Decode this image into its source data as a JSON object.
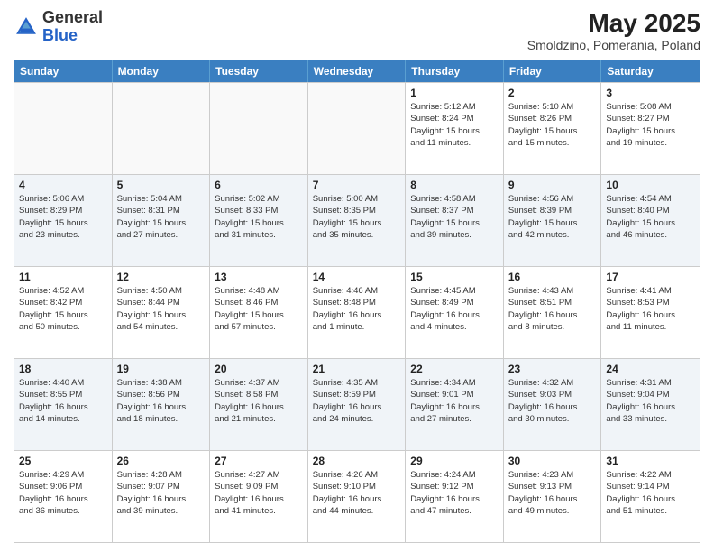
{
  "logo": {
    "general": "General",
    "blue": "Blue"
  },
  "header": {
    "title": "May 2025",
    "subtitle": "Smoldzino, Pomerania, Poland"
  },
  "weekdays": [
    "Sunday",
    "Monday",
    "Tuesday",
    "Wednesday",
    "Thursday",
    "Friday",
    "Saturday"
  ],
  "rows": [
    [
      {
        "day": "",
        "info": ""
      },
      {
        "day": "",
        "info": ""
      },
      {
        "day": "",
        "info": ""
      },
      {
        "day": "",
        "info": ""
      },
      {
        "day": "1",
        "info": "Sunrise: 5:12 AM\nSunset: 8:24 PM\nDaylight: 15 hours\nand 11 minutes."
      },
      {
        "day": "2",
        "info": "Sunrise: 5:10 AM\nSunset: 8:26 PM\nDaylight: 15 hours\nand 15 minutes."
      },
      {
        "day": "3",
        "info": "Sunrise: 5:08 AM\nSunset: 8:27 PM\nDaylight: 15 hours\nand 19 minutes."
      }
    ],
    [
      {
        "day": "4",
        "info": "Sunrise: 5:06 AM\nSunset: 8:29 PM\nDaylight: 15 hours\nand 23 minutes."
      },
      {
        "day": "5",
        "info": "Sunrise: 5:04 AM\nSunset: 8:31 PM\nDaylight: 15 hours\nand 27 minutes."
      },
      {
        "day": "6",
        "info": "Sunrise: 5:02 AM\nSunset: 8:33 PM\nDaylight: 15 hours\nand 31 minutes."
      },
      {
        "day": "7",
        "info": "Sunrise: 5:00 AM\nSunset: 8:35 PM\nDaylight: 15 hours\nand 35 minutes."
      },
      {
        "day": "8",
        "info": "Sunrise: 4:58 AM\nSunset: 8:37 PM\nDaylight: 15 hours\nand 39 minutes."
      },
      {
        "day": "9",
        "info": "Sunrise: 4:56 AM\nSunset: 8:39 PM\nDaylight: 15 hours\nand 42 minutes."
      },
      {
        "day": "10",
        "info": "Sunrise: 4:54 AM\nSunset: 8:40 PM\nDaylight: 15 hours\nand 46 minutes."
      }
    ],
    [
      {
        "day": "11",
        "info": "Sunrise: 4:52 AM\nSunset: 8:42 PM\nDaylight: 15 hours\nand 50 minutes."
      },
      {
        "day": "12",
        "info": "Sunrise: 4:50 AM\nSunset: 8:44 PM\nDaylight: 15 hours\nand 54 minutes."
      },
      {
        "day": "13",
        "info": "Sunrise: 4:48 AM\nSunset: 8:46 PM\nDaylight: 15 hours\nand 57 minutes."
      },
      {
        "day": "14",
        "info": "Sunrise: 4:46 AM\nSunset: 8:48 PM\nDaylight: 16 hours\nand 1 minute."
      },
      {
        "day": "15",
        "info": "Sunrise: 4:45 AM\nSunset: 8:49 PM\nDaylight: 16 hours\nand 4 minutes."
      },
      {
        "day": "16",
        "info": "Sunrise: 4:43 AM\nSunset: 8:51 PM\nDaylight: 16 hours\nand 8 minutes."
      },
      {
        "day": "17",
        "info": "Sunrise: 4:41 AM\nSunset: 8:53 PM\nDaylight: 16 hours\nand 11 minutes."
      }
    ],
    [
      {
        "day": "18",
        "info": "Sunrise: 4:40 AM\nSunset: 8:55 PM\nDaylight: 16 hours\nand 14 minutes."
      },
      {
        "day": "19",
        "info": "Sunrise: 4:38 AM\nSunset: 8:56 PM\nDaylight: 16 hours\nand 18 minutes."
      },
      {
        "day": "20",
        "info": "Sunrise: 4:37 AM\nSunset: 8:58 PM\nDaylight: 16 hours\nand 21 minutes."
      },
      {
        "day": "21",
        "info": "Sunrise: 4:35 AM\nSunset: 8:59 PM\nDaylight: 16 hours\nand 24 minutes."
      },
      {
        "day": "22",
        "info": "Sunrise: 4:34 AM\nSunset: 9:01 PM\nDaylight: 16 hours\nand 27 minutes."
      },
      {
        "day": "23",
        "info": "Sunrise: 4:32 AM\nSunset: 9:03 PM\nDaylight: 16 hours\nand 30 minutes."
      },
      {
        "day": "24",
        "info": "Sunrise: 4:31 AM\nSunset: 9:04 PM\nDaylight: 16 hours\nand 33 minutes."
      }
    ],
    [
      {
        "day": "25",
        "info": "Sunrise: 4:29 AM\nSunset: 9:06 PM\nDaylight: 16 hours\nand 36 minutes."
      },
      {
        "day": "26",
        "info": "Sunrise: 4:28 AM\nSunset: 9:07 PM\nDaylight: 16 hours\nand 39 minutes."
      },
      {
        "day": "27",
        "info": "Sunrise: 4:27 AM\nSunset: 9:09 PM\nDaylight: 16 hours\nand 41 minutes."
      },
      {
        "day": "28",
        "info": "Sunrise: 4:26 AM\nSunset: 9:10 PM\nDaylight: 16 hours\nand 44 minutes."
      },
      {
        "day": "29",
        "info": "Sunrise: 4:24 AM\nSunset: 9:12 PM\nDaylight: 16 hours\nand 47 minutes."
      },
      {
        "day": "30",
        "info": "Sunrise: 4:23 AM\nSunset: 9:13 PM\nDaylight: 16 hours\nand 49 minutes."
      },
      {
        "day": "31",
        "info": "Sunrise: 4:22 AM\nSunset: 9:14 PM\nDaylight: 16 hours\nand 51 minutes."
      }
    ]
  ]
}
